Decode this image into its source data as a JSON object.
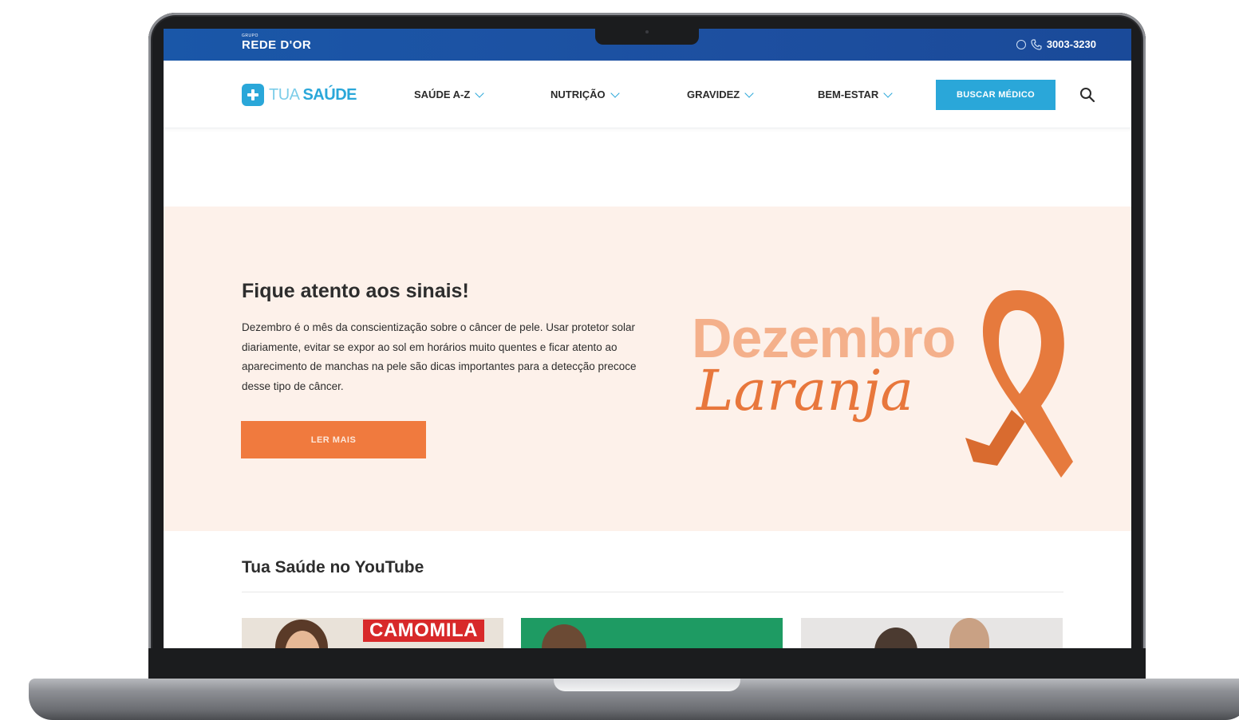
{
  "topbar": {
    "brand_small": "GRUPO",
    "brand": "REDE D'OR",
    "phone": "3003-3230"
  },
  "nav": {
    "logo_prefix": "TUA",
    "logo_main": "SAÚDE",
    "menu": [
      {
        "label": "SAÚDE A-Z"
      },
      {
        "label": "NUTRIÇÃO"
      },
      {
        "label": "GRAVIDEZ"
      },
      {
        "label": "BEM-ESTAR"
      }
    ],
    "cta": "BUSCAR MÉDICO"
  },
  "hero": {
    "title": "Fique atento aos sinais!",
    "text": "Dezembro é o mês da conscientização sobre o câncer de pele. Usar protetor solar diariamente, evitar se expor ao sol em horários muito quentes e ficar atento ao aparecimento de manchas na pele são dicas importantes para a detecção precoce desse tipo de câncer.",
    "button": "LER MAIS",
    "campaign_line1": "Dezembro",
    "campaign_line2": "Laranja"
  },
  "youtube": {
    "title": "Tua Saúde no YouTube",
    "thumb1_caption": "CAMOMILA"
  },
  "colors": {
    "brand_blue": "#1d4fa0",
    "accent_cyan": "#2aa7d9",
    "orange": "#f07a3e",
    "hero_bg": "#fdf1ea"
  }
}
